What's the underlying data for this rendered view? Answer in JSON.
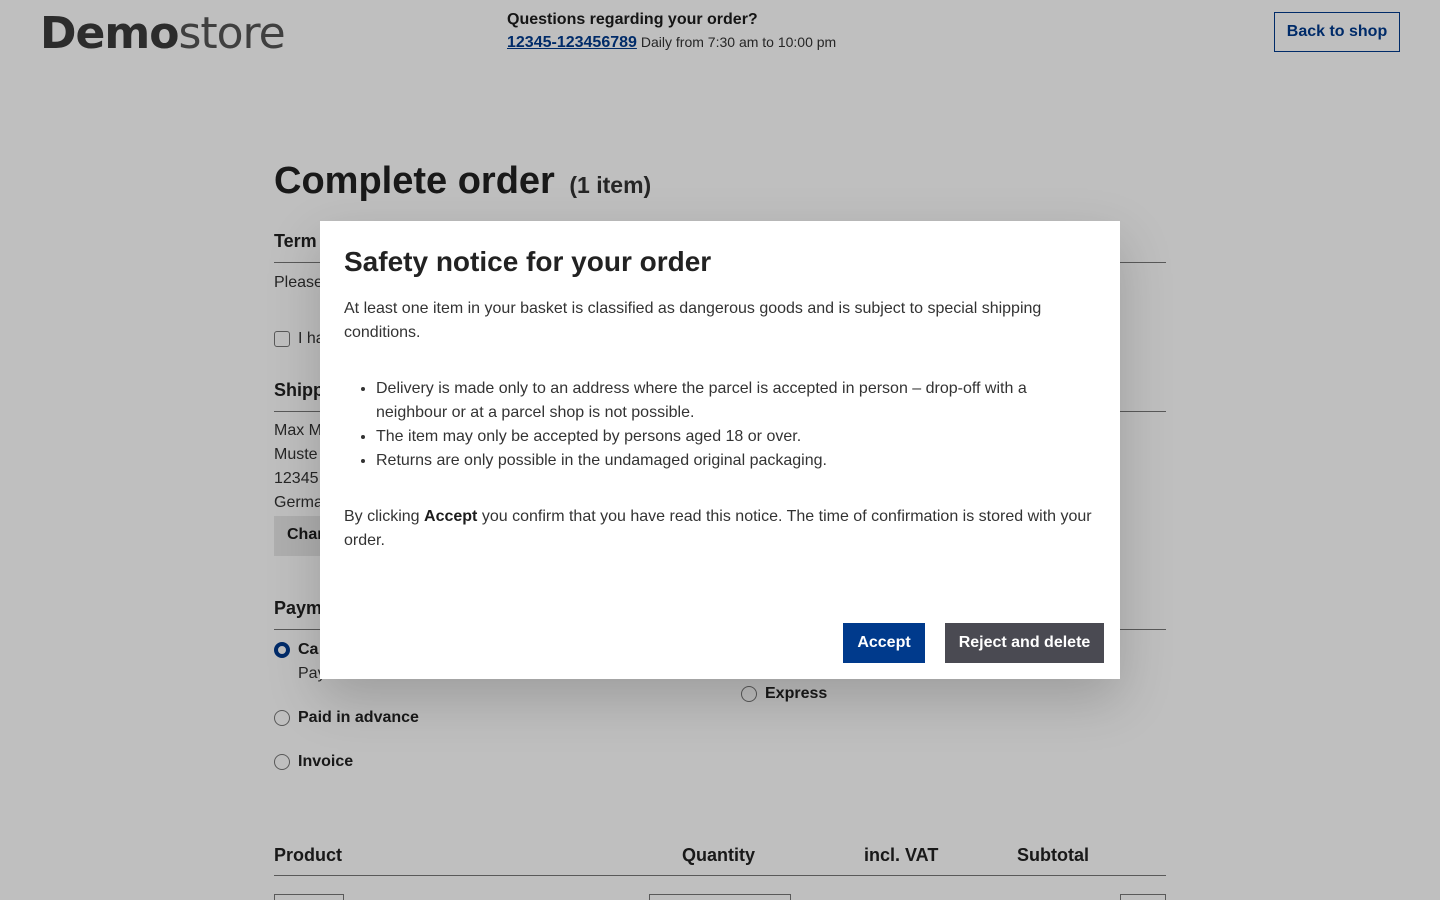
{
  "header": {
    "logo_bold": "Demo",
    "logo_light": "store",
    "contact_question": "Questions regarding your order?",
    "phone": "12345-123456789",
    "hours": "Daily from 7:30 am to 10:00 pm",
    "back_label": "Back to shop"
  },
  "main": {
    "title": "Complete order",
    "item_count": "(1 item)",
    "terms_heading": "Term",
    "terms_text": "Please",
    "terms_checkbox_label": "I ha",
    "shipping_heading": "Shipp",
    "address_lines": [
      "Max M",
      "Muste",
      "12345",
      "Germa"
    ],
    "change_label": "Char",
    "payment_heading": "Paym",
    "payment_options": [
      {
        "label": "Ca",
        "sub": "Pay",
        "selected": true
      },
      {
        "label": "Paid in advance",
        "selected": false
      },
      {
        "label": "Invoice",
        "selected": false
      }
    ],
    "shipping_options": [
      {
        "label": "Express",
        "selected": false
      }
    ],
    "table_headers": [
      "Product",
      "Quantity",
      "incl. VAT",
      "Subtotal"
    ]
  },
  "modal": {
    "title": "Safety notice for your order",
    "intro": "At least one item in your basket is classified as dangerous goods and is subject to special shipping conditions.",
    "bullets": [
      "Delivery is made only to an address where the parcel is accepted in person – drop-off with a neighbour or at a parcel shop is not possible.",
      "The item may only be accepted by persons aged 18 or over.",
      "Returns are only possible in the undamaged original packaging."
    ],
    "confirm_prefix": "By clicking ",
    "confirm_bold": "Accept",
    "confirm_suffix": " you confirm that you have read this notice. The time of confirmation is stored with your order.",
    "accept_label": "Accept",
    "reject_label": "Reject and delete"
  },
  "colors": {
    "accent": "#003a8c",
    "reject_button": "#4a4a52",
    "overlay": "rgba(0,0,0,0.25)"
  }
}
